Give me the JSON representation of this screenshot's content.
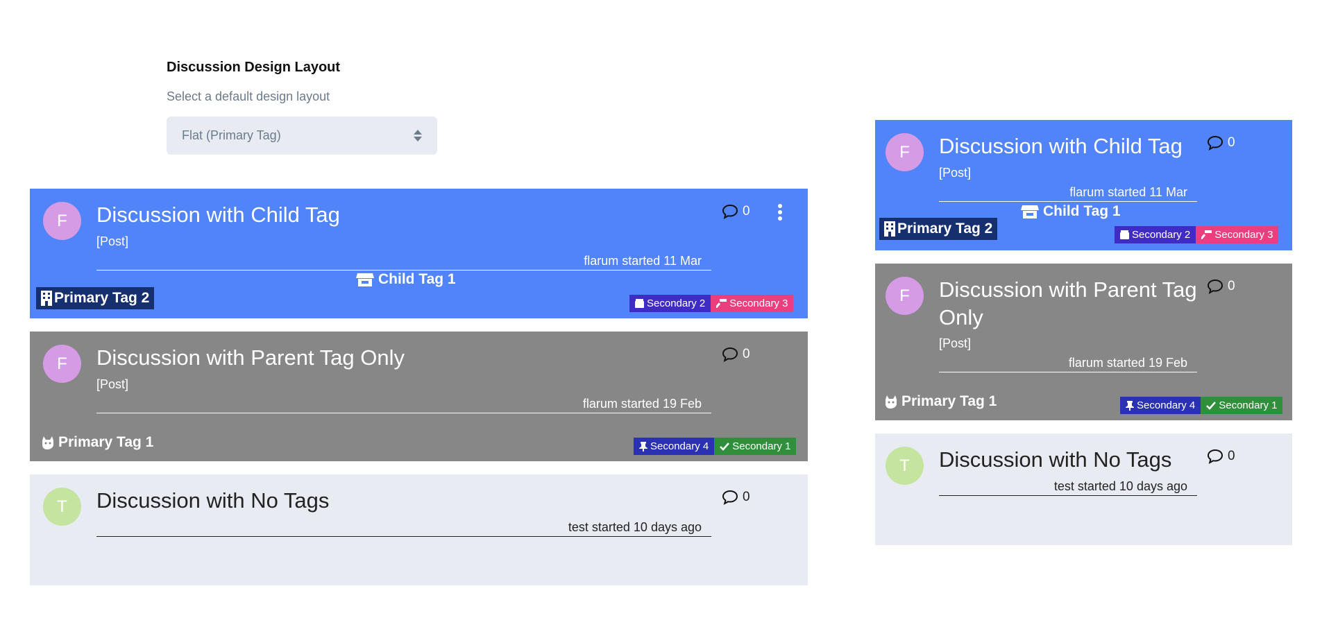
{
  "settings": {
    "label": "Discussion Design Layout",
    "help": "Select a default design layout",
    "select_value": "Flat (Primary Tag)"
  },
  "colors": {
    "blue_card": "#5184f8",
    "gray_card": "#878787",
    "light_card": "#e8ecf2",
    "primary_tag_bg": "#16306f",
    "secondary_2": "#3f2cc4",
    "secondary_3": "#ea3e7e",
    "secondary_4": "#2a32b3",
    "secondary_1": "#2f8f3b"
  },
  "discussions": [
    {
      "avatar": "F",
      "title": "Discussion with Child Tag",
      "sub": "[Post]",
      "meta": "flarum started 11 Mar",
      "replies": "0",
      "child_tag": "Child Tag 1",
      "child_tag_icon": "store-icon",
      "primary_tag": "Primary Tag 2",
      "primary_tag_icon": "building-icon",
      "secondary": [
        {
          "label": "Secondary 2",
          "icon": "box-icon"
        },
        {
          "label": "Secondary 3",
          "icon": "hammer-icon"
        }
      ]
    },
    {
      "avatar": "F",
      "title": "Discussion with Parent Tag Only",
      "title_line1": "Discussion with Parent Tag",
      "title_line2": "Only",
      "sub": "[Post]",
      "meta": "flarum started 19 Feb",
      "replies": "0",
      "primary_tag": "Primary Tag 1",
      "primary_tag_icon": "cat-icon",
      "secondary": [
        {
          "label": "Secondary 4",
          "icon": "thumbtack-icon"
        },
        {
          "label": "Secondary 1",
          "icon": "check-icon"
        }
      ]
    },
    {
      "avatar": "T",
      "title": "Discussion with No Tags",
      "meta": "test started 10 days ago",
      "replies": "0"
    }
  ]
}
